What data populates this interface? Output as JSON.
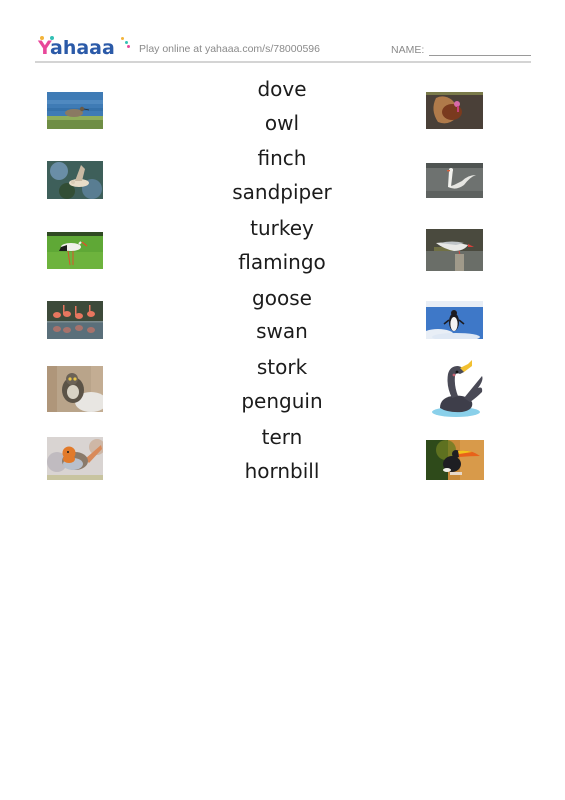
{
  "header": {
    "logo_text": "Yahaaa",
    "play_online": "Play online at yahaaa.com/s/78000596",
    "name_label": "NAME:"
  },
  "words": [
    "dove",
    "owl",
    "finch",
    "sandpiper",
    "turkey",
    "flamingo",
    "goose",
    "swan",
    "stork",
    "penguin",
    "tern",
    "hornbill"
  ],
  "left_images": [
    {
      "icon": "sandpiper-photo",
      "subject": "sandpiper"
    },
    {
      "icon": "dove-photo",
      "subject": "dove"
    },
    {
      "icon": "stork-photo",
      "subject": "stork"
    },
    {
      "icon": "flamingo-photo",
      "subject": "flamingo"
    },
    {
      "icon": "owl-photo",
      "subject": "owl"
    },
    {
      "icon": "finch-photo",
      "subject": "finch"
    }
  ],
  "right_images": [
    {
      "icon": "turkey-photo",
      "subject": "turkey"
    },
    {
      "icon": "swan-photo",
      "subject": "swan"
    },
    {
      "icon": "tern-photo",
      "subject": "tern"
    },
    {
      "icon": "penguin-photo",
      "subject": "penguin"
    },
    {
      "icon": "goose-illustration",
      "subject": "goose"
    },
    {
      "icon": "hornbill-photo",
      "subject": "hornbill"
    }
  ],
  "colors": {
    "logo_blue": "#2b5aa8",
    "logo_pink": "#e8479a",
    "header_text": "#8a8a8a",
    "word_text": "#1c1c1c"
  }
}
